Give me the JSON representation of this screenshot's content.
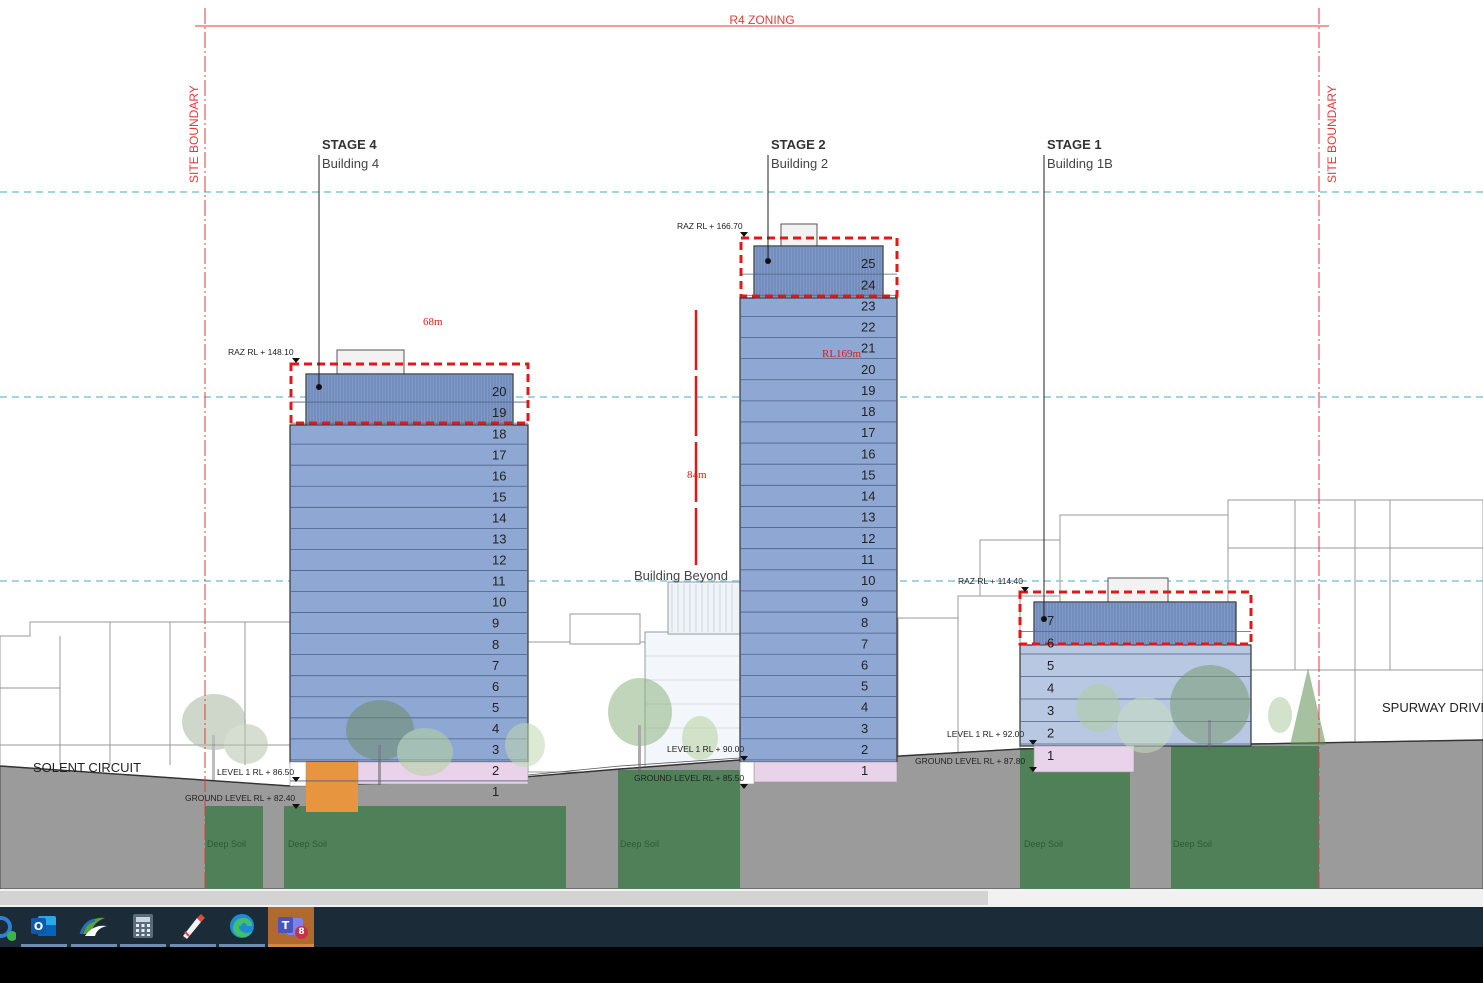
{
  "drawing": {
    "zoning_label": "R4 ZONING",
    "site_boundary_left": "SITE BOUNDARY",
    "site_boundary_right": "SITE BOUNDARY",
    "street_left": "SOLENT CIRCUIT",
    "street_right": "SPURWAY DRIVE",
    "building_beyond": "Building Beyond",
    "deep_soil": "Deep Soil",
    "annotation_68m": "68m",
    "annotation_84m": "84m",
    "annotation_rl169": "RL169m",
    "buildings": {
      "b4": {
        "stage": "STAGE 4",
        "name": "Building 4",
        "raz": "RAZ RL + 148.10",
        "level1": "LEVEL 1 RL + 86.50",
        "ground": "GROUND LEVEL RL + 82.40",
        "floors": [
          "20",
          "19",
          "18",
          "17",
          "16",
          "15",
          "14",
          "13",
          "12",
          "11",
          "10",
          "9",
          "8",
          "7",
          "6",
          "5",
          "4",
          "3",
          "2",
          "1"
        ]
      },
      "b2": {
        "stage": "STAGE 2",
        "name": "Building 2",
        "raz": "RAZ RL + 166.70",
        "level1": "LEVEL 1 RL + 90.00",
        "ground": "GROUND LEVEL RL + 85.50",
        "floors": [
          "25",
          "24",
          "23",
          "22",
          "21",
          "20",
          "19",
          "18",
          "17",
          "16",
          "15",
          "14",
          "13",
          "12",
          "11",
          "10",
          "9",
          "8",
          "7",
          "6",
          "5",
          "4",
          "3",
          "2",
          "1"
        ]
      },
      "b1": {
        "stage": "STAGE 1",
        "name": "Building 1B",
        "raz": "RAZ RL + 114.40",
        "level1": "LEVEL 1 RL + 92.00",
        "ground": "GROUND LEVEL RL + 87.80",
        "floors": [
          "7",
          "6",
          "5",
          "4",
          "3",
          "2",
          "1"
        ]
      }
    }
  },
  "taskbar": {
    "items": [
      {
        "icon": "sync-app-icon"
      },
      {
        "icon": "outlook-icon"
      },
      {
        "icon": "citrix-icon"
      },
      {
        "icon": "calculator-icon"
      },
      {
        "icon": "pen-drawing-app-icon"
      },
      {
        "icon": "edge-browser-icon"
      },
      {
        "icon": "teams-icon",
        "badge": "8"
      }
    ]
  },
  "colors": {
    "tower_blue": "#8fa8d3",
    "crown_blue": "#7f99c8",
    "retail_pink": "#e8d3ea",
    "ground_grey": "#9b9b9b",
    "deep_soil_green": "#4f8058",
    "boundary_red": "#e23b3b",
    "dashed_cyan": "#7fc6dc",
    "highlight_red": "#e01818"
  }
}
